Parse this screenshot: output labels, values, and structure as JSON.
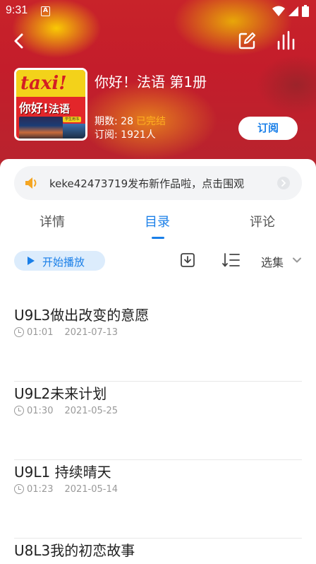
{
  "status_bar": {
    "time": "9:31",
    "app_icon_letter": "A"
  },
  "nav": {
    "back_icon": "back-arrow-icon",
    "edit_icon": "edit-icon",
    "stats_icon": "bars-icon"
  },
  "cover": {
    "brand": "taxi!",
    "title_cn": "你好!",
    "title_cn2": "法语",
    "badge": "学生用书"
  },
  "book": {
    "title": "你好！法语 第1册",
    "issues_label": "期数: 28",
    "status": "已完结",
    "subscribers_label": "订阅: 1921人",
    "subscribe_button": "订阅"
  },
  "notice": {
    "text": "keke42473719发布新作品啦，点击围观"
  },
  "tabs": [
    {
      "label": "详情"
    },
    {
      "label": "目录"
    },
    {
      "label": "评论"
    }
  ],
  "active_tab": "目录",
  "toolbar": {
    "play_label": "开始播放",
    "select_label": "选集"
  },
  "episodes": [
    {
      "title": "U9L3做出改变的意愿",
      "duration": "01:01",
      "date": "2021-07-13"
    },
    {
      "title": "U9L2未来计划",
      "duration": "01:30",
      "date": "2021-05-25"
    },
    {
      "title": "U9L1 持续晴天",
      "duration": "01:23",
      "date": "2021-05-14"
    },
    {
      "title": "U8L3我的初恋故事",
      "duration": "",
      "date": ""
    }
  ],
  "colors": {
    "accent": "#1a7fe8",
    "status_done": "#ffb020",
    "hero_red": "#c8232a"
  }
}
